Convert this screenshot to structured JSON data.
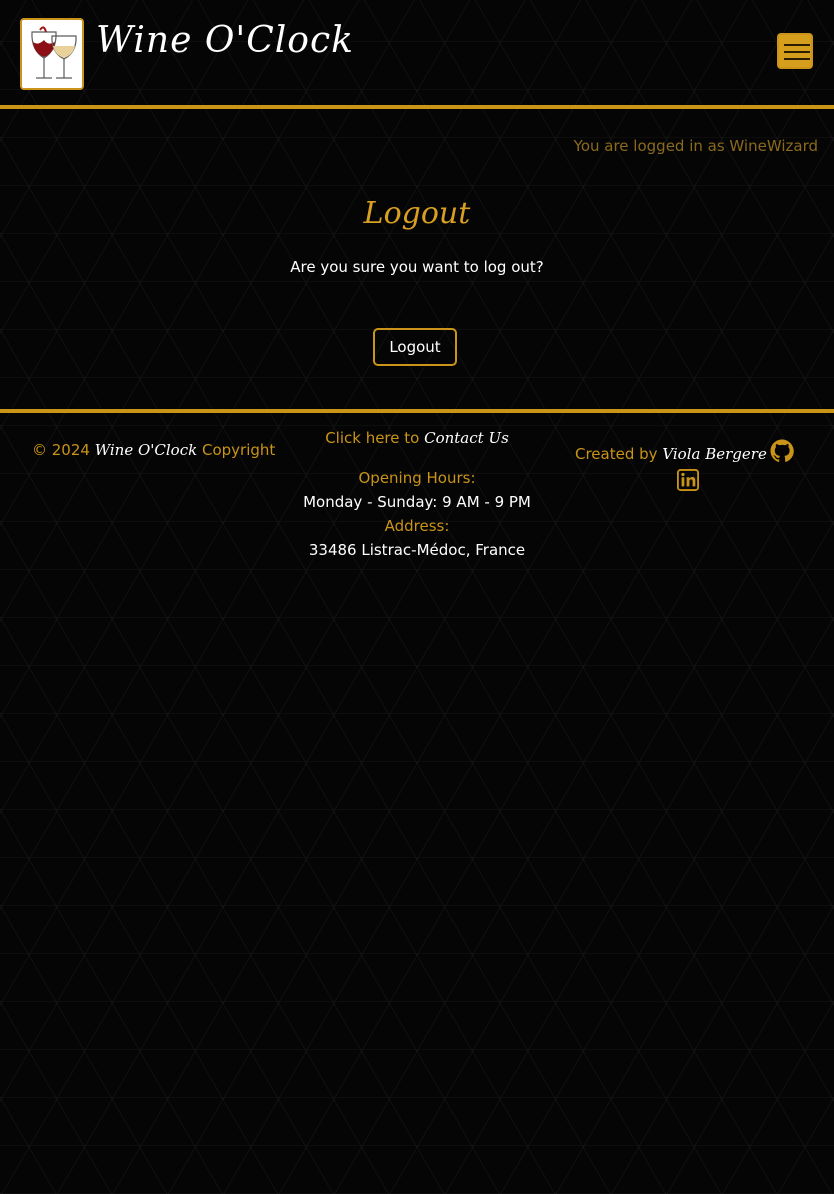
{
  "header": {
    "brand": "Wine O'Clock",
    "logo_icon": "wine-glasses-logo",
    "menu_icon": "hamburger-menu-icon"
  },
  "login_status": "You are logged in as WineWizard",
  "main": {
    "title": "Logout",
    "confirm_text": "Are you sure you want to log out?",
    "logout_button": "Logout"
  },
  "footer": {
    "copyright_prefix": "© 2024",
    "copyright_brand": "Wine O'Clock",
    "copyright_suffix": "Copyright",
    "contact_prefix": "Click here to",
    "contact_link": "Contact Us",
    "hours_label": "Opening Hours:",
    "hours_value": "Monday - Sunday: 9 AM - 9 PM",
    "address_label": "Address:",
    "address_value": "33486 Listrac-Médoc, France",
    "created_prefix": "Created by",
    "created_name": "Viola Bergere",
    "social_icons": [
      "github-icon",
      "linkedin-icon"
    ]
  },
  "colors": {
    "accent": "#c99417",
    "background": "#050505",
    "text": "#ffffff"
  }
}
